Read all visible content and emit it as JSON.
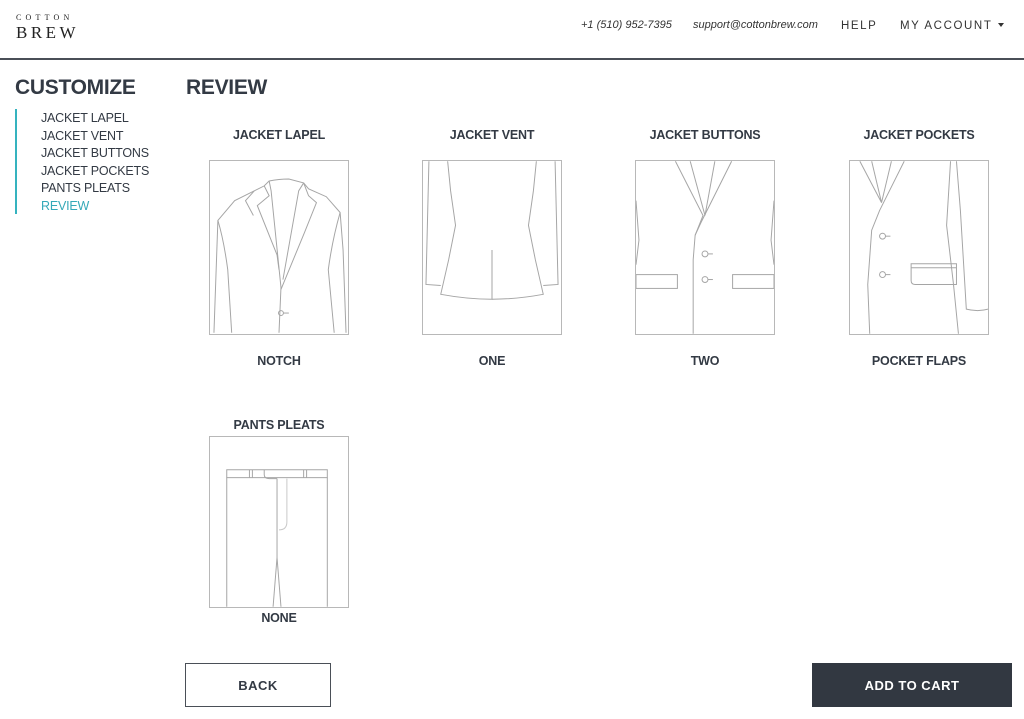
{
  "brand": {
    "logo_top": "COTTON",
    "logo_bottom": "BREW"
  },
  "header": {
    "phone": "+1 (510) 952-7395",
    "email": "support@cottonbrew.com",
    "help_label": "HELP",
    "account_label": "MY ACCOUNT"
  },
  "sidebar": {
    "title": "CUSTOMIZE",
    "items": [
      {
        "label": "JACKET LAPEL",
        "active": false
      },
      {
        "label": "JACKET VENT",
        "active": false
      },
      {
        "label": "JACKET BUTTONS",
        "active": false
      },
      {
        "label": "JACKET POCKETS",
        "active": false
      },
      {
        "label": "PANTS PLEATS",
        "active": false
      },
      {
        "label": "REVIEW",
        "active": true
      }
    ],
    "accent_color": "#35b3bf"
  },
  "main": {
    "title": "REVIEW",
    "selections": [
      {
        "category": "JACKET LAPEL",
        "value": "NOTCH",
        "icon": "jacket-lapel-notch-illustration"
      },
      {
        "category": "JACKET VENT",
        "value": "ONE",
        "icon": "jacket-vent-one-illustration"
      },
      {
        "category": "JACKET BUTTONS",
        "value": "TWO",
        "icon": "jacket-buttons-two-illustration"
      },
      {
        "category": "JACKET POCKETS",
        "value": "POCKET FLAPS",
        "icon": "jacket-pockets-flaps-illustration"
      },
      {
        "category": "PANTS PLEATS",
        "value": "NONE",
        "icon": "pants-pleats-none-illustration"
      }
    ]
  },
  "actions": {
    "back_label": "BACK",
    "add_to_cart_label": "ADD TO CART",
    "primary_color": "#323841"
  }
}
